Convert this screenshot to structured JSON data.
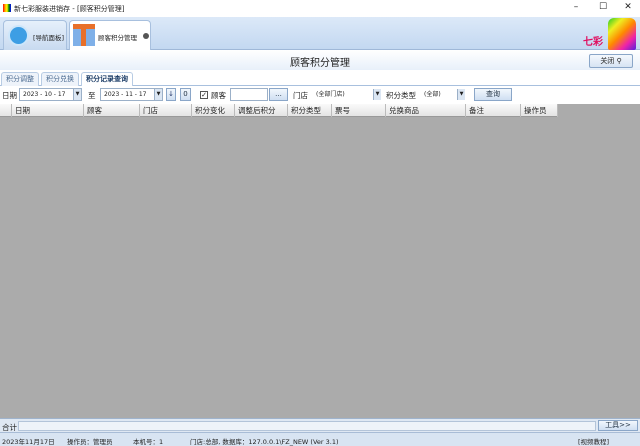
{
  "window": {
    "title": "新七彩服装进销存 - [顾客积分管理]",
    "min": "–",
    "max": "☐",
    "close": "✕"
  },
  "doc_tabs": [
    {
      "label": "[导航面板]"
    },
    {
      "label": "顾客积分管理"
    }
  ],
  "logo_text": "七彩",
  "header": {
    "title": "顾客积分管理",
    "close_label": "关闭"
  },
  "sub_tabs": [
    {
      "label": "积分调整"
    },
    {
      "label": "积分兑换"
    },
    {
      "label": "积分记录查询",
      "active": true
    }
  ],
  "filter": {
    "date_label": "日期",
    "date_from": "2023 - 10 - 17",
    "to_label": "至",
    "date_to": "2023 - 11 - 17",
    "btn_down": "↓",
    "btn_zero": "0",
    "customer_label": "顾客",
    "customer_checked": true,
    "customer_value": "",
    "browse": "...",
    "store_label": "门店",
    "store_value": "(全部门店)",
    "type_label": "积分类型",
    "type_value": "(全部)",
    "query": "查询"
  },
  "table": {
    "columns": [
      "日期",
      "顾客",
      "门店",
      "积分变化",
      "调整后积分",
      "积分类型",
      "票号",
      "兑换商品",
      "备注",
      "操作员"
    ],
    "rows": []
  },
  "footer": {
    "sum_label": "合计",
    "tools": "工具>>"
  },
  "status": {
    "date": "2023年11月17日",
    "operator": "操作员：管理员",
    "machine": "本机号：1",
    "db": "门店:总部, 数据库：127.0.0.1\\FZ_NEW (Ver 3.1)",
    "video": "[视频教程]"
  }
}
